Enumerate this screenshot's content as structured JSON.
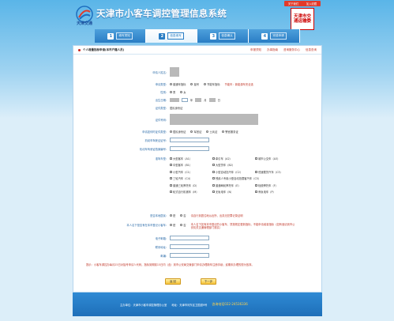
{
  "header": {
    "logo_text": "天津交通",
    "title": "天津市小客车调控管理信息系统",
    "top_links": [
      "关于我们",
      "加入收藏"
    ],
    "seal_text": "天津市交通运输委"
  },
  "steps": [
    {
      "num": "1",
      "label": "填写须知",
      "active": false
    },
    {
      "num": "2",
      "label": "信息填写",
      "active": true
    },
    {
      "num": "3",
      "label": "信息确认",
      "active": false
    },
    {
      "num": "4",
      "label": "完成申请",
      "active": false
    }
  ],
  "form": {
    "heading": "个人增量指标申请(本市户籍人员)",
    "head_links": [
      "申报须知",
      "办事指南",
      "咨询服务中心",
      "信息查询"
    ],
    "name_label": "申请人姓名:",
    "applicant_type_label": "申请类型:",
    "applicant_types": [
      "普通车指标",
      "摇号",
      "节能车指标"
    ],
    "applicant_hint": "节能车：新能源车完全选",
    "gender_label": "性别:",
    "genders": [
      "男",
      "女"
    ],
    "birth_label": "出生日期:",
    "birth_units": [
      "年",
      "月",
      "日"
    ],
    "id_type_label": "证件类型:",
    "id_type_value": "居民身份证",
    "id_no_label": "证件号码:",
    "doc_type_label": "申请如何时证件类型:",
    "doc_types": [
      "居民身份证",
      "军官证",
      "士兵证",
      "警官服务证"
    ],
    "vehicle_id_label": "机动车驾驶证证号:",
    "vehicle_file_label": "机动车驾驶证档案编号:",
    "vehicle_type_label": "准驾车型:",
    "vehicle_types": [
      "大型客车（A1）",
      "牵引车（A2）",
      "城市公交车（A3）",
      "中型客车（B1）",
      "大型货车（B2）",
      "",
      "小型汽车（C1）",
      "小型自动挡汽车（C2）",
      "低速载货汽车（C3）",
      "三轮汽车（C4）",
      "残疾人专用小型自动挡载客汽车（C5）",
      "",
      "普通三轮摩托车（D）",
      "普通两轮摩托车（E）",
      "轻便摩托车（F）",
      "轮式自行机械车（M）",
      "无轨电车（N）",
      "有轨电车（P）"
    ],
    "resident_label": "是否本地居民:",
    "resident_options": [
      "是",
      "否"
    ],
    "resident_hint": "请自行到居住地派出所，出具无犯罪记录证明",
    "house_label": "本人名下是否有在本市登记小客车:",
    "house_options": [
      "是",
      "否"
    ],
    "house_hint": "本人名下如有本市登记的小客车，须按规定更新指标，不能申请增量指标（如有误请到市公安机关交通管理部门核实）",
    "email_label": "电子邮箱:",
    "postal_label": "联系地址:",
    "zip_label": "邮编:",
    "note": "提示：小客车调控办每月25日对摇号申请人代码，指标到期前15日内（含）到市公安局交管部门申请办理新车注册手续；逾期未办理的视为放弃。",
    "back_button": "返 回",
    "next_button": "下一步"
  },
  "footer": {
    "org": "主办单位：天津市小客车调控管理办公室",
    "address": "地址：天津市河东区卫国道9号",
    "phone": "咨询电话022-24536336"
  },
  "colors": {
    "accent": "#2a7dc4",
    "warning": "#c0392b",
    "button": "#f6c33a"
  }
}
